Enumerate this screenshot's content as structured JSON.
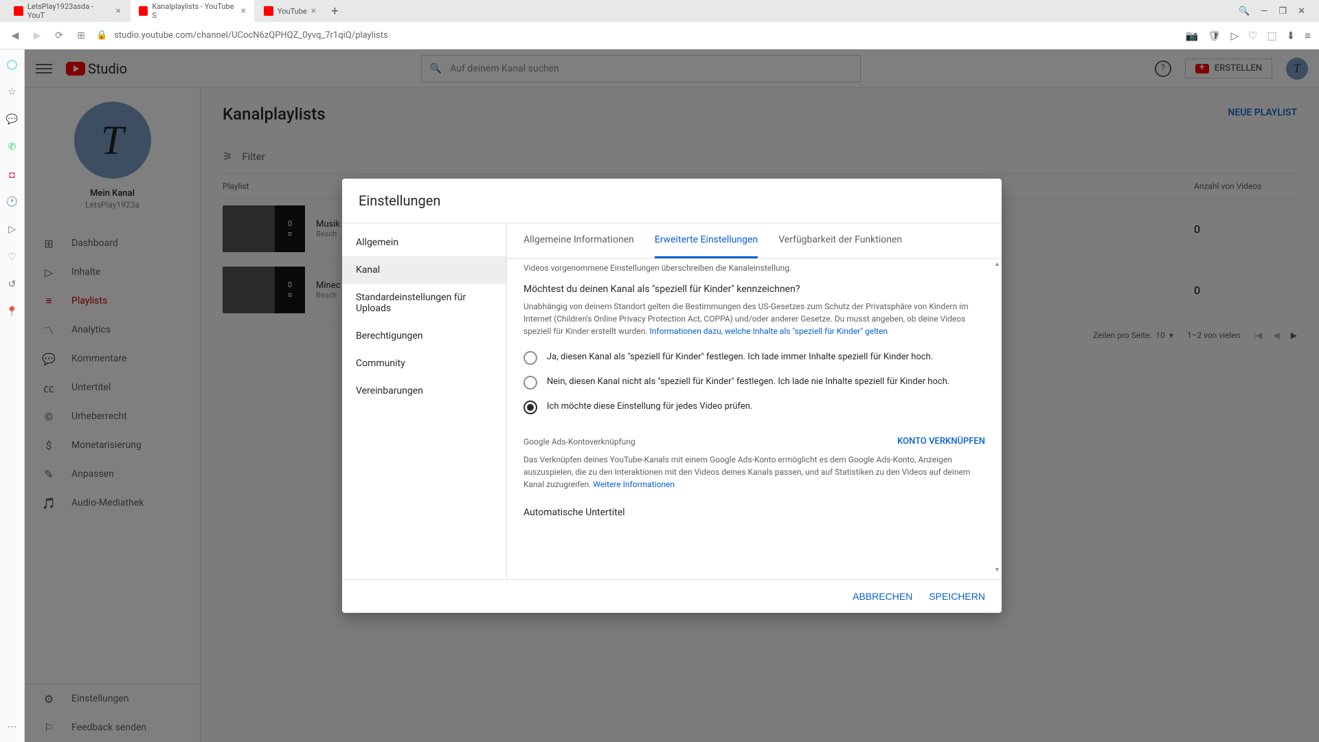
{
  "browser": {
    "tabs": [
      {
        "title": "LetsPlay1923asda - YouT",
        "favicon_bg": "#ff0000"
      },
      {
        "title": "Kanalplaylists - YouTube S",
        "favicon_bg": "#ff0000"
      },
      {
        "title": "YouTube",
        "favicon_bg": "#ff0000"
      }
    ],
    "url": "studio.youtube.com/channel/UCocN6zQPHQZ_0yvq_7r1qiQ/playlists",
    "window_controls": {
      "min": "—",
      "max": "❐",
      "close": "✕",
      "search": "🔍"
    }
  },
  "header": {
    "logo_text": "Studio",
    "search_placeholder": "Auf deinem Kanal suchen",
    "create_label": "ERSTELLEN",
    "avatar_letter": "T"
  },
  "channel": {
    "avatar_letter": "T",
    "name_label": "Mein Kanal",
    "handle": "LetsPlay1923a"
  },
  "nav": {
    "items": [
      {
        "icon": "⊞",
        "label": "Dashboard"
      },
      {
        "icon": "▷",
        "label": "Inhalte"
      },
      {
        "icon": "≡",
        "label": "Playlists"
      },
      {
        "icon": "〽",
        "label": "Analytics"
      },
      {
        "icon": "💬",
        "label": "Kommentare"
      },
      {
        "icon": "㏄",
        "label": "Untertitel"
      },
      {
        "icon": "©",
        "label": "Urheberrecht"
      },
      {
        "icon": "$",
        "label": "Monetarisierung"
      },
      {
        "icon": "✎",
        "label": "Anpassen"
      },
      {
        "icon": "🎵",
        "label": "Audio-Mediathek"
      }
    ],
    "bottom": [
      {
        "icon": "⚙",
        "label": "Einstellungen"
      },
      {
        "icon": "⚐",
        "label": "Feedback senden"
      }
    ]
  },
  "page": {
    "title": "Kanalplaylists",
    "new_playlist": "NEUE PLAYLIST",
    "filter_label": "Filter",
    "col_playlist": "Playlist",
    "col_count": "Anzahl von Videos",
    "rows": [
      {
        "name": "Musik",
        "sub": "Besch",
        "count": "0",
        "overlay_count": "0"
      },
      {
        "name": "Minec",
        "sub": "Besch",
        "count": "0",
        "overlay_count": "0"
      }
    ],
    "pagination": {
      "rows_label": "Zeilen pro Seite:",
      "rows_value": "10",
      "range": "1–2 von vielen"
    }
  },
  "modal": {
    "title": "Einstellungen",
    "nav": [
      "Allgemein",
      "Kanal",
      "Standardeinstellungen für Uploads",
      "Berechtigungen",
      "Community",
      "Vereinbarungen"
    ],
    "tabs": [
      "Allgemeine Informationen",
      "Erweiterte Einstellungen",
      "Verfügbarkeit der Funktionen"
    ],
    "intro_fragment": "Videos vorgenommene Einstellungen überschreiben die Kanaleinstellung.",
    "question": "Möchtest du deinen Kanal als \"speziell für Kinder\" kennzeichnen?",
    "legal_text": "Unabhängig von deinem Standort gelten die Bestimmungen des US-Gesetzes zum Schutz der Privatsphäre von Kindern im Internet (Children's Online Privacy Protection Act, COPPA) und/oder anderer Gesetze. Du musst angeben, ob deine Videos speziell für Kinder erstellt wurden. ",
    "legal_link": "Informationen dazu, welche Inhalte als \"speziell für Kinder\" gelten",
    "radios": [
      "Ja, diesen Kanal als \"speziell für Kinder\" festlegen. Ich lade immer Inhalte speziell für Kinder hoch.",
      "Nein, diesen Kanal nicht als \"speziell für Kinder\" festlegen. Ich lade nie Inhalte speziell für Kinder hoch.",
      "Ich möchte diese Einstellung für jedes Video prüfen."
    ],
    "ads_title": "Google Ads-Kontoverknüpfung",
    "ads_link": "KONTO VERKNÜPFEN",
    "ads_text": "Das Verknüpfen deines YouTube-Kanals mit einem Google Ads-Konto ermöglicht es dem Google Ads-Konto, Anzeigen auszuspielen, die zu den Interaktionen mit den Videos deines Kanals passen, und auf Statistiken zu den Videos auf deinem Kanal zuzugreifen. ",
    "ads_more": "Weitere Informationen",
    "subtitle_section": "Automatische Untertitel",
    "cancel": "ABBRECHEN",
    "save": "SPEICHERN"
  }
}
